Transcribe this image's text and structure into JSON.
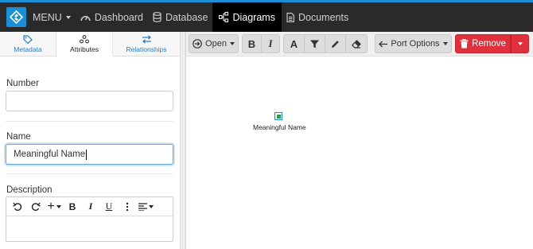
{
  "nav": {
    "menu_label": "MENU",
    "items": [
      {
        "label": "Dashboard",
        "icon": "dashboard-icon"
      },
      {
        "label": "Database",
        "icon": "database-icon"
      },
      {
        "label": "Diagrams",
        "icon": "diagram-icon"
      },
      {
        "label": "Documents",
        "icon": "document-icon"
      }
    ],
    "active": "Diagrams"
  },
  "sidebar": {
    "tabs": [
      {
        "label": "Metadata",
        "icon": "tag-icon"
      },
      {
        "label": "Attributes",
        "icon": "attributes-icon"
      },
      {
        "label": "Relationships",
        "icon": "swap-arrows-icon"
      }
    ],
    "active_tab": "Attributes",
    "fields": {
      "number_label": "Number",
      "number_value": "",
      "name_label": "Name",
      "name_value": "Meaningful Name",
      "description_label": "Description"
    },
    "editor_tools": [
      "undo",
      "redo",
      "+",
      "B",
      "I",
      "U",
      "more",
      "align"
    ]
  },
  "toolbar": {
    "open_label": "Open",
    "port_options_label": "Port Options",
    "remove_label": "Remove"
  },
  "canvas": {
    "node_label": "Meaningful Name"
  },
  "colors": {
    "accent": "#1a8fd6",
    "topbar": "#2a2a2a",
    "remove": "#e0303b",
    "node_core": "#2e9b4e"
  }
}
